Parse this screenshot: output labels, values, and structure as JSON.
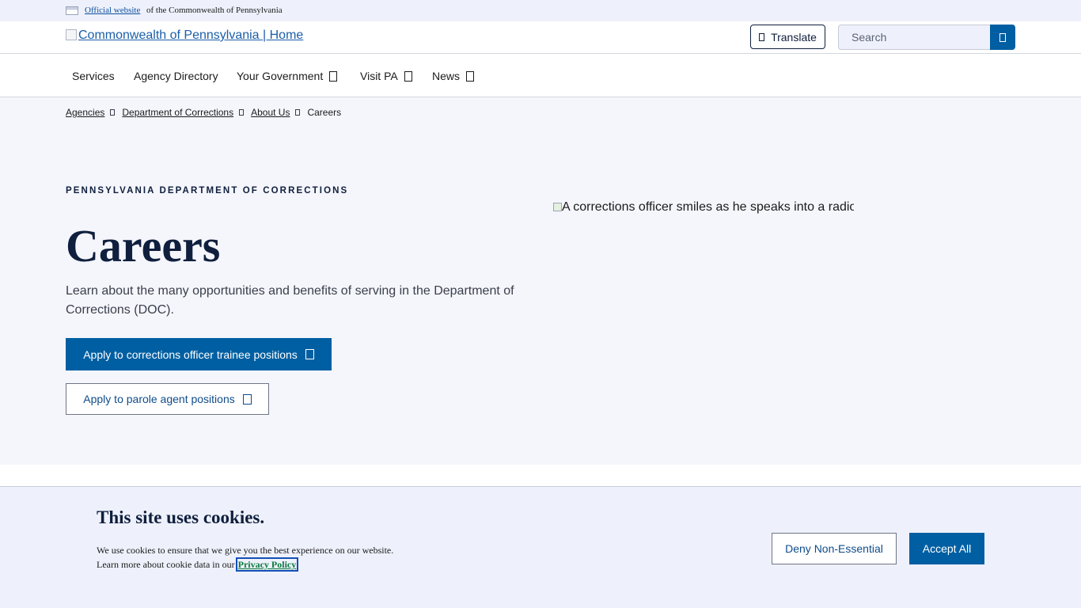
{
  "gov_banner": {
    "official_link": "Official website",
    "suffix": "of the Commonwealth of Pennsylvania"
  },
  "header": {
    "logo_alt": "Commonwealth of Pennsylvania | Home",
    "translate_label": "Translate",
    "search_placeholder": "Search"
  },
  "nav": {
    "items": [
      {
        "label": "Services"
      },
      {
        "label": "Agency Directory"
      },
      {
        "label": "Your Government"
      },
      {
        "label": "Visit PA"
      },
      {
        "label": "News"
      }
    ]
  },
  "breadcrumb": {
    "items": [
      "Agencies",
      "Department of Corrections",
      "About Us"
    ],
    "current": "Careers"
  },
  "hero": {
    "eyebrow": "PENNSYLVANIA DEPARTMENT OF CORRECTIONS",
    "title": "Careers",
    "lead": "Learn about the many opportunities and benefits of serving in the Department of Corrections (DOC).",
    "primary_button": "Apply to corrections officer trainee positions",
    "secondary_button": "Apply to parole agent positions",
    "image_alt": "A corrections officer smiles as he speaks into a radio"
  },
  "cookie": {
    "title": "This site uses cookies.",
    "line1": "We use cookies to ensure that we give you the best experience on our website.",
    "line2_prefix": "Learn more about cookie data in our",
    "link": "Privacy Policy",
    "deny_label": "Deny Non-Essential",
    "accept_label": "Accept All"
  },
  "colors": {
    "brand_blue": "#005fa2",
    "navy": "#0f1f3d",
    "hero_bg": "#f5f6fc",
    "banner_bg": "#eef1fb"
  }
}
